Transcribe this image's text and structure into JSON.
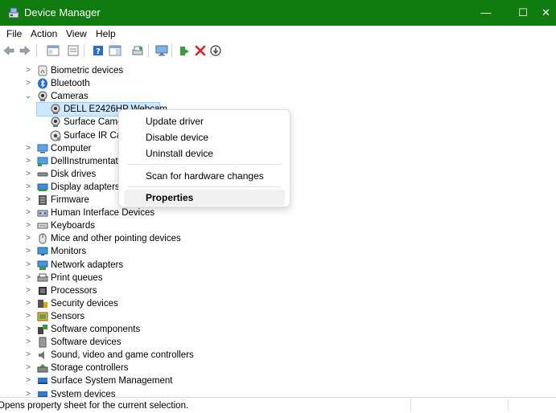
{
  "window": {
    "title": "Device Manager",
    "controls": {
      "minimize": "—",
      "maximize": "☐",
      "close": "✕"
    }
  },
  "menu": [
    "File",
    "Action",
    "View",
    "Help"
  ],
  "tree": [
    {
      "label": "Biometric devices",
      "icon": "fingerprint-icon",
      "expander": ">"
    },
    {
      "label": "Bluetooth",
      "icon": "bluetooth-icon",
      "expander": ">"
    },
    {
      "label": "Cameras",
      "icon": "camera-icon",
      "expander": "⌄"
    },
    {
      "label": "DELL E2426HP Webcam",
      "icon": "webcam-icon",
      "child": true,
      "selected": true
    },
    {
      "label": "Surface Camera Front",
      "icon": "webcam-icon",
      "child": true
    },
    {
      "label": "Surface IR Camera Front",
      "icon": "ir-camera-icon",
      "child": true
    },
    {
      "label": "Computer",
      "icon": "computer-icon",
      "expander": ">"
    },
    {
      "label": "DellInstrumentation",
      "icon": "instrumentation-icon",
      "expander": ">"
    },
    {
      "label": "Disk drives",
      "icon": "disk-drive-icon",
      "expander": ">"
    },
    {
      "label": "Display adapters",
      "icon": "display-adapter-icon",
      "expander": ">"
    },
    {
      "label": "Firmware",
      "icon": "firmware-icon",
      "expander": ">"
    },
    {
      "label": "Human Interface Devices",
      "icon": "hid-icon",
      "expander": ">"
    },
    {
      "label": "Keyboards",
      "icon": "keyboard-icon",
      "expander": ">"
    },
    {
      "label": "Mice and other pointing devices",
      "icon": "mouse-icon",
      "expander": ">"
    },
    {
      "label": "Monitors",
      "icon": "monitor-icon",
      "expander": ">"
    },
    {
      "label": "Network adapters",
      "icon": "network-adapter-icon",
      "expander": ">"
    },
    {
      "label": "Print queues",
      "icon": "printer-icon",
      "expander": ">"
    },
    {
      "label": "Processors",
      "icon": "processor-icon",
      "expander": ">"
    },
    {
      "label": "Security devices",
      "icon": "security-device-icon",
      "expander": ">"
    },
    {
      "label": "Sensors",
      "icon": "sensor-icon",
      "expander": ">"
    },
    {
      "label": "Software components",
      "icon": "software-component-icon",
      "expander": ">"
    },
    {
      "label": "Software devices",
      "icon": "software-device-icon",
      "expander": ">"
    },
    {
      "label": "Sound, video and game controllers",
      "icon": "speaker-icon",
      "expander": ">"
    },
    {
      "label": "Storage controllers",
      "icon": "storage-controller-icon",
      "expander": ">"
    },
    {
      "label": "Surface System Management",
      "icon": "surface-management-icon",
      "expander": ">"
    },
    {
      "label": "System devices",
      "icon": "system-device-icon",
      "expander": ">"
    }
  ],
  "context_menu": {
    "items": [
      "Update driver",
      "Disable device",
      "Uninstall device",
      "Scan for hardware changes",
      "Properties"
    ]
  },
  "status": {
    "text": "Opens property sheet for the current selection."
  },
  "colors": {
    "titlebar": "#107c10",
    "selection": "#cce8ff"
  }
}
